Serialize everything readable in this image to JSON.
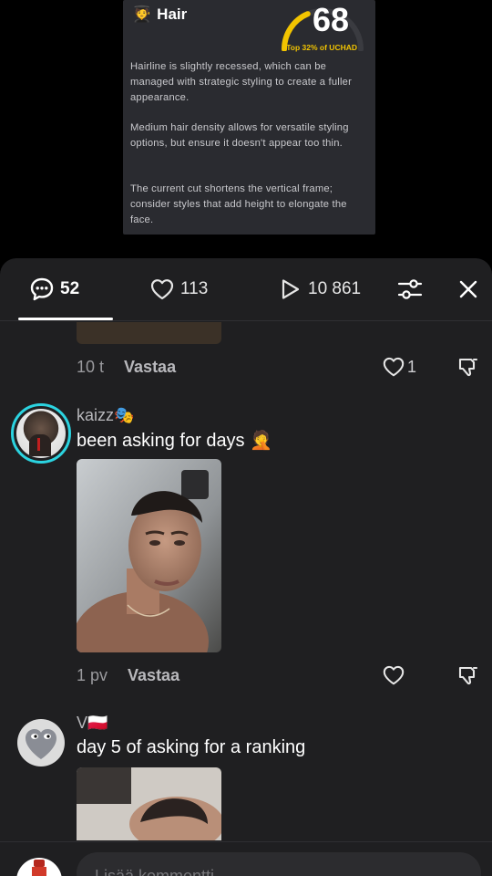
{
  "video": {
    "hair_card": {
      "icon": "student-emoji",
      "title_emoji": "🧑‍🎓",
      "title": "Hair",
      "score": "68",
      "score_fraction": 0.68,
      "rank_text": "Top 32% of UCHAD",
      "paragraphs": [
        "Hairline is slightly recessed, which can be managed with strategic styling to create a fuller appearance.",
        "Medium hair density allows for versatile styling options, but ensure it doesn't appear too thin.",
        "The current cut shortens the vertical frame; consider styles that add height to elongate the face."
      ],
      "colors": {
        "card": "#2a2b30",
        "gauge": "#f2c400",
        "rank": "#f2c400"
      }
    }
  },
  "stats": {
    "comments": "52",
    "likes": "113",
    "plays": "10 861",
    "icons": [
      "comment-icon",
      "heart-icon",
      "play-icon",
      "filter-icon",
      "close-icon"
    ]
  },
  "comments": [
    {
      "time": "10 t",
      "reply_label": "Vastaa",
      "likes": "1"
    },
    {
      "username": "kaizz🎭",
      "text": "been asking for days 🤦",
      "time": "1 pv",
      "reply_label": "Vastaa",
      "likes": ""
    },
    {
      "username": "V🇵🇱",
      "text": "day 5 of asking for a ranking"
    }
  ],
  "input": {
    "placeholder": "Lisää kommentti..."
  },
  "accent": {
    "story_ring": "#2bd3e0"
  }
}
